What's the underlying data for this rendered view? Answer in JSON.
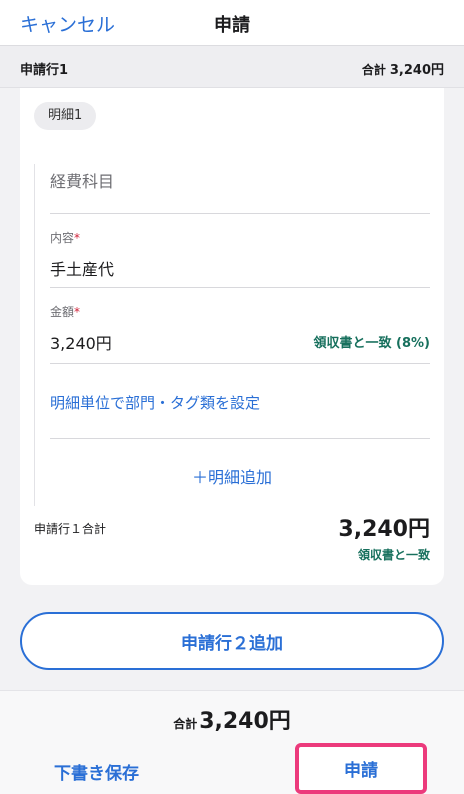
{
  "header": {
    "cancel_label": "キャンセル",
    "title": "申請"
  },
  "subheader": {
    "line_label": "申請行1",
    "total_label": "合計",
    "total_value": "3,240円"
  },
  "detail": {
    "chip": "明細1",
    "category_placeholder": "経費科目",
    "content_label": "内容",
    "content_value": "手土産代",
    "amount_label": "金額",
    "amount_value": "3,240円",
    "receipt_match": "領収書と一致 (8%)",
    "dept_tag_link": "明細単位で部門・タグ類を設定",
    "required_mark": "*",
    "add_item": "＋明細追加",
    "line_total_label": "申請行１合計",
    "line_total_value": "3,240円",
    "line_total_match": "領収書と一致"
  },
  "add_line_button": "申請行２追加",
  "footer": {
    "total_label": "合計",
    "total_value": "3,240円",
    "draft_label": "下書き保存",
    "submit_label": "申請"
  },
  "colors": {
    "accent": "#2a6fd6",
    "success": "#17705d",
    "required": "#d0233a",
    "highlight": "#ec3a7c"
  }
}
